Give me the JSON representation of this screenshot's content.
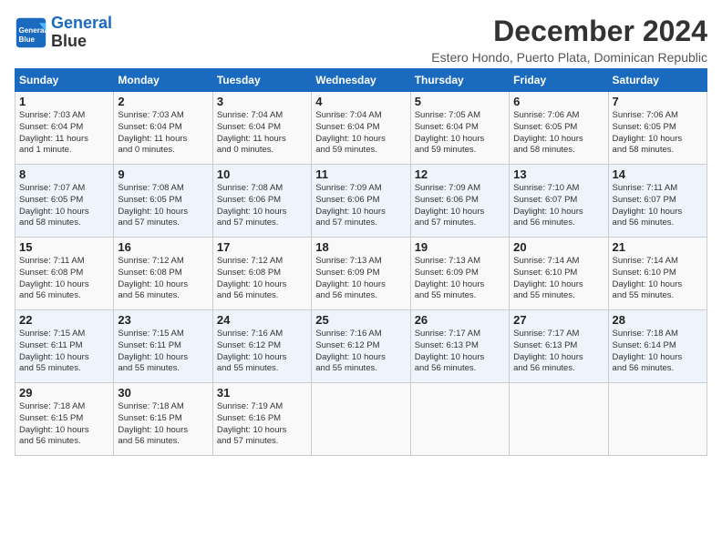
{
  "header": {
    "logo_line1": "General",
    "logo_line2": "Blue",
    "month": "December 2024",
    "location": "Estero Hondo, Puerto Plata, Dominican Republic"
  },
  "days_of_week": [
    "Sunday",
    "Monday",
    "Tuesday",
    "Wednesday",
    "Thursday",
    "Friday",
    "Saturday"
  ],
  "weeks": [
    [
      {
        "day": 1,
        "info": "Sunrise: 7:03 AM\nSunset: 6:04 PM\nDaylight: 11 hours\nand 1 minute."
      },
      {
        "day": 2,
        "info": "Sunrise: 7:03 AM\nSunset: 6:04 PM\nDaylight: 11 hours\nand 0 minutes."
      },
      {
        "day": 3,
        "info": "Sunrise: 7:04 AM\nSunset: 6:04 PM\nDaylight: 11 hours\nand 0 minutes."
      },
      {
        "day": 4,
        "info": "Sunrise: 7:04 AM\nSunset: 6:04 PM\nDaylight: 10 hours\nand 59 minutes."
      },
      {
        "day": 5,
        "info": "Sunrise: 7:05 AM\nSunset: 6:04 PM\nDaylight: 10 hours\nand 59 minutes."
      },
      {
        "day": 6,
        "info": "Sunrise: 7:06 AM\nSunset: 6:05 PM\nDaylight: 10 hours\nand 58 minutes."
      },
      {
        "day": 7,
        "info": "Sunrise: 7:06 AM\nSunset: 6:05 PM\nDaylight: 10 hours\nand 58 minutes."
      }
    ],
    [
      {
        "day": 8,
        "info": "Sunrise: 7:07 AM\nSunset: 6:05 PM\nDaylight: 10 hours\nand 58 minutes."
      },
      {
        "day": 9,
        "info": "Sunrise: 7:08 AM\nSunset: 6:05 PM\nDaylight: 10 hours\nand 57 minutes."
      },
      {
        "day": 10,
        "info": "Sunrise: 7:08 AM\nSunset: 6:06 PM\nDaylight: 10 hours\nand 57 minutes."
      },
      {
        "day": 11,
        "info": "Sunrise: 7:09 AM\nSunset: 6:06 PM\nDaylight: 10 hours\nand 57 minutes."
      },
      {
        "day": 12,
        "info": "Sunrise: 7:09 AM\nSunset: 6:06 PM\nDaylight: 10 hours\nand 57 minutes."
      },
      {
        "day": 13,
        "info": "Sunrise: 7:10 AM\nSunset: 6:07 PM\nDaylight: 10 hours\nand 56 minutes."
      },
      {
        "day": 14,
        "info": "Sunrise: 7:11 AM\nSunset: 6:07 PM\nDaylight: 10 hours\nand 56 minutes."
      }
    ],
    [
      {
        "day": 15,
        "info": "Sunrise: 7:11 AM\nSunset: 6:08 PM\nDaylight: 10 hours\nand 56 minutes."
      },
      {
        "day": 16,
        "info": "Sunrise: 7:12 AM\nSunset: 6:08 PM\nDaylight: 10 hours\nand 56 minutes."
      },
      {
        "day": 17,
        "info": "Sunrise: 7:12 AM\nSunset: 6:08 PM\nDaylight: 10 hours\nand 56 minutes."
      },
      {
        "day": 18,
        "info": "Sunrise: 7:13 AM\nSunset: 6:09 PM\nDaylight: 10 hours\nand 56 minutes."
      },
      {
        "day": 19,
        "info": "Sunrise: 7:13 AM\nSunset: 6:09 PM\nDaylight: 10 hours\nand 55 minutes."
      },
      {
        "day": 20,
        "info": "Sunrise: 7:14 AM\nSunset: 6:10 PM\nDaylight: 10 hours\nand 55 minutes."
      },
      {
        "day": 21,
        "info": "Sunrise: 7:14 AM\nSunset: 6:10 PM\nDaylight: 10 hours\nand 55 minutes."
      }
    ],
    [
      {
        "day": 22,
        "info": "Sunrise: 7:15 AM\nSunset: 6:11 PM\nDaylight: 10 hours\nand 55 minutes."
      },
      {
        "day": 23,
        "info": "Sunrise: 7:15 AM\nSunset: 6:11 PM\nDaylight: 10 hours\nand 55 minutes."
      },
      {
        "day": 24,
        "info": "Sunrise: 7:16 AM\nSunset: 6:12 PM\nDaylight: 10 hours\nand 55 minutes."
      },
      {
        "day": 25,
        "info": "Sunrise: 7:16 AM\nSunset: 6:12 PM\nDaylight: 10 hours\nand 55 minutes."
      },
      {
        "day": 26,
        "info": "Sunrise: 7:17 AM\nSunset: 6:13 PM\nDaylight: 10 hours\nand 56 minutes."
      },
      {
        "day": 27,
        "info": "Sunrise: 7:17 AM\nSunset: 6:13 PM\nDaylight: 10 hours\nand 56 minutes."
      },
      {
        "day": 28,
        "info": "Sunrise: 7:18 AM\nSunset: 6:14 PM\nDaylight: 10 hours\nand 56 minutes."
      }
    ],
    [
      {
        "day": 29,
        "info": "Sunrise: 7:18 AM\nSunset: 6:15 PM\nDaylight: 10 hours\nand 56 minutes."
      },
      {
        "day": 30,
        "info": "Sunrise: 7:18 AM\nSunset: 6:15 PM\nDaylight: 10 hours\nand 56 minutes."
      },
      {
        "day": 31,
        "info": "Sunrise: 7:19 AM\nSunset: 6:16 PM\nDaylight: 10 hours\nand 57 minutes."
      },
      null,
      null,
      null,
      null
    ]
  ]
}
